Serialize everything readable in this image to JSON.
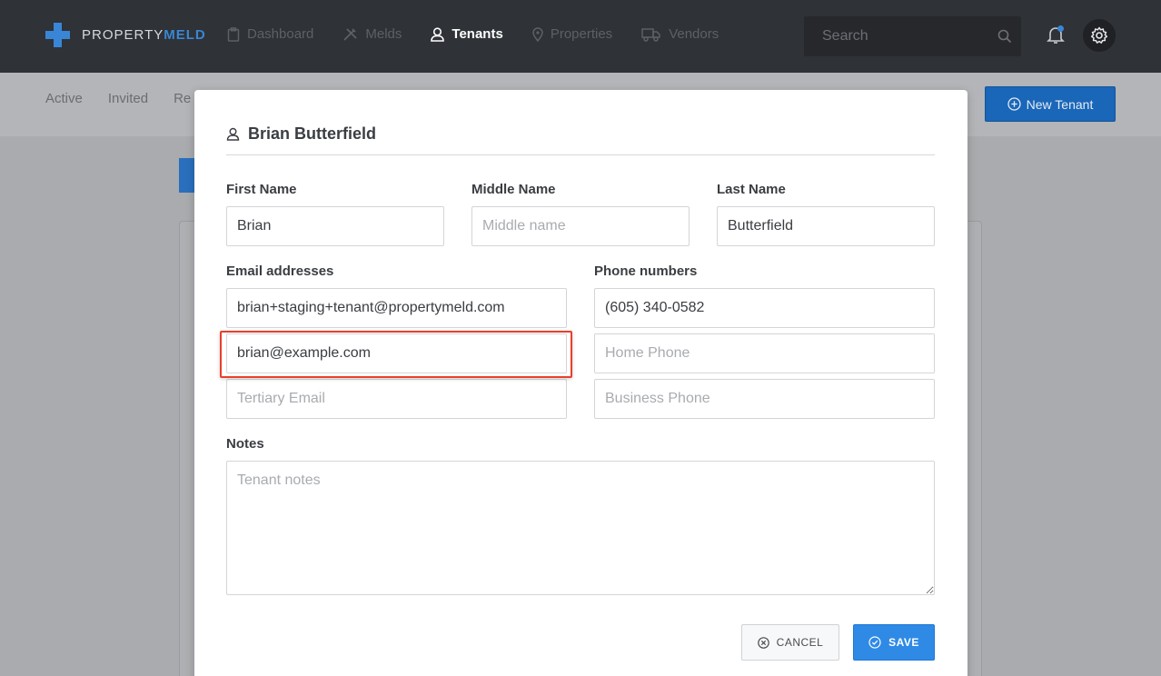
{
  "app": {
    "logo_prefix": "PROPERTY",
    "logo_suffix": "MELD"
  },
  "nav": {
    "items": [
      {
        "label": "Dashboard",
        "icon": "clipboard-icon"
      },
      {
        "label": "Melds",
        "icon": "tools-icon"
      },
      {
        "label": "Tenants",
        "icon": "user-icon",
        "active": true
      },
      {
        "label": "Properties",
        "icon": "map-pin-icon"
      },
      {
        "label": "Vendors",
        "icon": "truck-icon"
      }
    ],
    "search_placeholder": "Search"
  },
  "subnav": {
    "tabs": [
      "Active",
      "Invited",
      "Re"
    ],
    "new_tenant_label": "New Tenant"
  },
  "modal": {
    "title": "Brian Butterfield",
    "first_name_label": "First Name",
    "first_name_value": "Brian",
    "middle_name_label": "Middle Name",
    "middle_name_placeholder": "Middle name",
    "last_name_label": "Last Name",
    "last_name_value": "Butterfield",
    "email_label": "Email addresses",
    "email_primary": "brian+staging+tenant@propertymeld.com",
    "email_secondary": "brian@example.com",
    "email_tertiary_placeholder": "Tertiary Email",
    "phone_label": "Phone numbers",
    "phone_cell": "(605) 340-0582",
    "phone_home_placeholder": "Home Phone",
    "phone_business_placeholder": "Business Phone",
    "notes_label": "Notes",
    "notes_placeholder": "Tenant notes",
    "cancel_label": "CANCEL",
    "save_label": "SAVE"
  },
  "colors": {
    "accent": "#2f8ae6",
    "highlight": "#e8402a",
    "topbar": "#2f3237"
  }
}
